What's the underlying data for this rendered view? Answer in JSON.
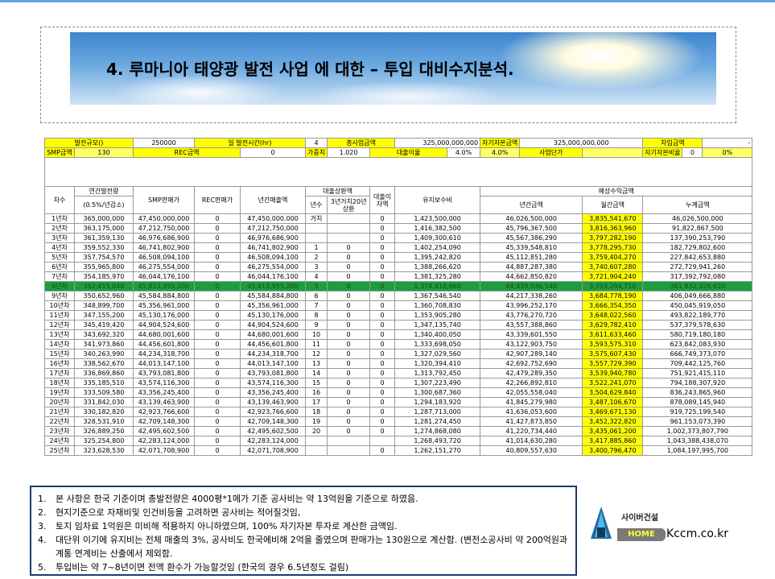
{
  "title": "4. 루마니아 태양광 발전 사업 에 대한 – 투입 대비수지분석.",
  "summary": {
    "capacity_label": "발전규모()",
    "capacity_value": "250000",
    "hours_label": "일 발전시간(hr)",
    "hours_value": "4",
    "total_label": "총사업금액",
    "total_value": "325,000,000,000",
    "equity_label": "자기자본금액",
    "equity_value": "325,000,000,000",
    "loan_label": "차입금액",
    "loan_value": "-",
    "smp_label": "SMP금액",
    "smp_value": "130",
    "rec_label": "REC금액",
    "rec_value": "0",
    "weight_label": "가중치",
    "weight_value": "1.020",
    "rate_label": "대출이율",
    "rate_value": "4.0%",
    "rate_value2": "4.0%",
    "unit_price_label": "사업단가",
    "equity_ratio_label": "자기자본비율",
    "equity_ratio_value": "0",
    "equity_ratio_pct": "0%"
  },
  "headers": {
    "year": "차수",
    "annual_gen": "연간발전량",
    "annual_gen_sub": "(0.5%/년감소)",
    "smp_sales": "SMP판매가",
    "rec_sales": "REC판매가",
    "annual_sales": "년간매출액",
    "loan_repay": "대출상환액",
    "loan_year": "년수",
    "loan_grace": "3년거치20년상환",
    "loan_interest": "대출이자액",
    "maintenance": "유지보수비",
    "expected": "예상수익금액",
    "yearly": "년간금액",
    "monthly": "월간금액",
    "cumulative": "누계금액"
  },
  "rows": [
    [
      "1년차",
      "365,000,000",
      "47,450,000,000",
      "0",
      "47,450,000,000",
      "거치",
      "",
      "0",
      "1,423,500,000",
      "46,026,500,000",
      "3,835,541,670",
      "46,026,500,000"
    ],
    [
      "2년차",
      "363,175,000",
      "47,212,750,000",
      "0",
      "47,212,750,000",
      "",
      "",
      "0",
      "1,416,382,500",
      "45,796,367,500",
      "3,816,363,960",
      "91,822,867,500"
    ],
    [
      "3년차",
      "361,359,130",
      "46,976,686,900",
      "0",
      "46,976,686,900",
      "",
      "",
      "0",
      "1,409,300,610",
      "45,567,386,290",
      "3,797,282,190",
      "137,390,253,790"
    ],
    [
      "4년차",
      "359,552,330",
      "46,741,802,900",
      "0",
      "46,741,802,900",
      "1",
      "0",
      "0",
      "1,402,254,090",
      "45,339,548,810",
      "3,778,295,730",
      "182,729,802,600"
    ],
    [
      "5년차",
      "357,754,570",
      "46,508,094,100",
      "0",
      "46,508,094,100",
      "2",
      "0",
      "0",
      "1,395,242,820",
      "45,112,851,280",
      "3,759,404,270",
      "227,842,653,880"
    ],
    [
      "6년차",
      "355,965,800",
      "46,275,554,000",
      "0",
      "46,275,554,000",
      "3",
      "0",
      "0",
      "1,388,266,620",
      "44,887,287,380",
      "3,740,607,280",
      "272,729,941,260"
    ],
    [
      "7년차",
      "354,185,970",
      "46,044,176,100",
      "0",
      "46,044,176,100",
      "4",
      "0",
      "0",
      "1,381,325,280",
      "44,662,850,820",
      "3,721,904,240",
      "317,392,792,080"
    ],
    [
      "8년차",
      "352,415,040",
      "45,813,955,200",
      "0",
      "45,813,955,200",
      "5",
      "0",
      "0",
      "1,374,418,660",
      "44,439,536,540",
      "3,703,294,710",
      "361,832,328,620"
    ],
    [
      "9년차",
      "350,652,960",
      "45,584,884,800",
      "0",
      "45,584,884,800",
      "6",
      "0",
      "0",
      "1,367,546,540",
      "44,217,338,260",
      "3,684,778,190",
      "406,049,666,880"
    ],
    [
      "10년차",
      "348,899,700",
      "45,356,961,000",
      "0",
      "45,356,961,000",
      "7",
      "0",
      "0",
      "1,360,708,830",
      "43,996,252,170",
      "3,666,354,350",
      "450,045,919,050"
    ],
    [
      "11년차",
      "347,155,200",
      "45,130,176,000",
      "0",
      "45,130,176,000",
      "8",
      "0",
      "0",
      "1,353,905,280",
      "43,776,270,720",
      "3,648,022,560",
      "493,822,189,770"
    ],
    [
      "12년차",
      "345,419,420",
      "44,904,524,600",
      "0",
      "44,904,524,600",
      "9",
      "0",
      "0",
      "1,347,135,740",
      "43,557,388,860",
      "3,629,782,410",
      "537,379,578,630"
    ],
    [
      "13년차",
      "343,692,320",
      "44,680,001,600",
      "0",
      "44,680,001,600",
      "10",
      "0",
      "0",
      "1,340,400,050",
      "43,339,601,550",
      "3,611,633,460",
      "580,719,180,180"
    ],
    [
      "14년차",
      "341,973,860",
      "44,456,601,800",
      "0",
      "44,456,601,800",
      "11",
      "0",
      "0",
      "1,333,698,050",
      "43,122,903,750",
      "3,593,575,310",
      "623,842,083,930"
    ],
    [
      "15년차",
      "340,263,990",
      "44,234,318,700",
      "0",
      "44,234,318,700",
      "12",
      "0",
      "0",
      "1,327,029,560",
      "42,907,289,140",
      "3,575,607,430",
      "666,749,373,070"
    ],
    [
      "16년차",
      "338,562,670",
      "44,013,147,100",
      "0",
      "44,013,147,100",
      "13",
      "0",
      "0",
      "1,320,394,410",
      "42,692,752,690",
      "3,557,729,390",
      "709,442,125,760"
    ],
    [
      "17년차",
      "336,869,860",
      "43,793,081,800",
      "0",
      "43,793,081,800",
      "14",
      "0",
      "0",
      "1,313,792,450",
      "42,479,289,350",
      "3,539,940,780",
      "751,921,415,110"
    ],
    [
      "18년차",
      "335,185,510",
      "43,574,116,300",
      "0",
      "43,574,116,300",
      "15",
      "0",
      "0",
      "1,307,223,490",
      "42,266,892,810",
      "3,522,241,070",
      "794,188,307,920"
    ],
    [
      "19년차",
      "333,509,580",
      "43,356,245,400",
      "0",
      "43,356,245,400",
      "16",
      "0",
      "0",
      "1,300,687,360",
      "42,055,558,040",
      "3,504,629,840",
      "836,243,865,960"
    ],
    [
      "20년차",
      "331,842,030",
      "43,139,463,900",
      "0",
      "43,139,463,900",
      "17",
      "0",
      "0",
      "1,294,183,920",
      "41,845,279,980",
      "3,487,106,670",
      "878,089,145,940"
    ],
    [
      "21년차",
      "330,182,820",
      "42,923,766,600",
      "0",
      "42,923,766,600",
      "18",
      "0",
      "0",
      "1,287,713,000",
      "41,636,053,600",
      "3,469,671,130",
      "919,725,199,540"
    ],
    [
      "22년차",
      "328,531,910",
      "42,709,148,300",
      "0",
      "42,709,148,300",
      "19",
      "0",
      "0",
      "1,281,274,450",
      "41,427,873,850",
      "3,452,322,820",
      "961,153,073,390"
    ],
    [
      "23년차",
      "326,889,250",
      "42,495,602,500",
      "0",
      "42,495,602,500",
      "20",
      "0",
      "0",
      "1,274,868,080",
      "41,220,734,440",
      "3,435,061,200",
      "1,002,373,807,790"
    ],
    [
      "24년차",
      "325,254,800",
      "42,283,124,000",
      "0",
      "42,283,124,000",
      "",
      "",
      "",
      "1,268,493,720",
      "41,014,630,280",
      "3,417,885,860",
      "1,043,388,438,070"
    ],
    [
      "25년차",
      "323,628,530",
      "42,071,708,900",
      "0",
      "42,071,708,900",
      "",
      "",
      "0",
      "1,262,151,270",
      "40,809,557,630",
      "3,400,796,470",
      "1,084,197,995,700"
    ]
  ],
  "highlight_row_index": 7,
  "notes": [
    {
      "num": "1.",
      "text": "본 사항은 한국 기준이며 총발전량은 4000평*1메가 기준 공사비는 약 13억원을 기준으로 하였음."
    },
    {
      "num": "2.",
      "text": "현지기준으로 자재비및 인건비등을 고려하면 공사비는 적어질것임,"
    },
    {
      "num": "3.",
      "text": "토지 임차료 1억원은 미비해 적용하지 아니하였으며, 100% 자기자본 투자로 계산한 금액임."
    },
    {
      "num": "4.",
      "text": "대단위 이기에 유지비는 전체 매출의 3%, 공사비도 한국에비해 2억을 줄였으며 판매가는 130원으로 계산함. (변전소공사비 약 200억원과  계통 연계비는 산출에서 제외함."
    },
    {
      "num": "5.",
      "text": "투입비는 약 7~8년이면 전액 환수가 가능할것임 (한국의 경우 6.5년정도 걸림)"
    }
  ],
  "logo": {
    "top_text": "사이버건설",
    "home_text": "HOME",
    "url": "Kccm.co.kr"
  }
}
